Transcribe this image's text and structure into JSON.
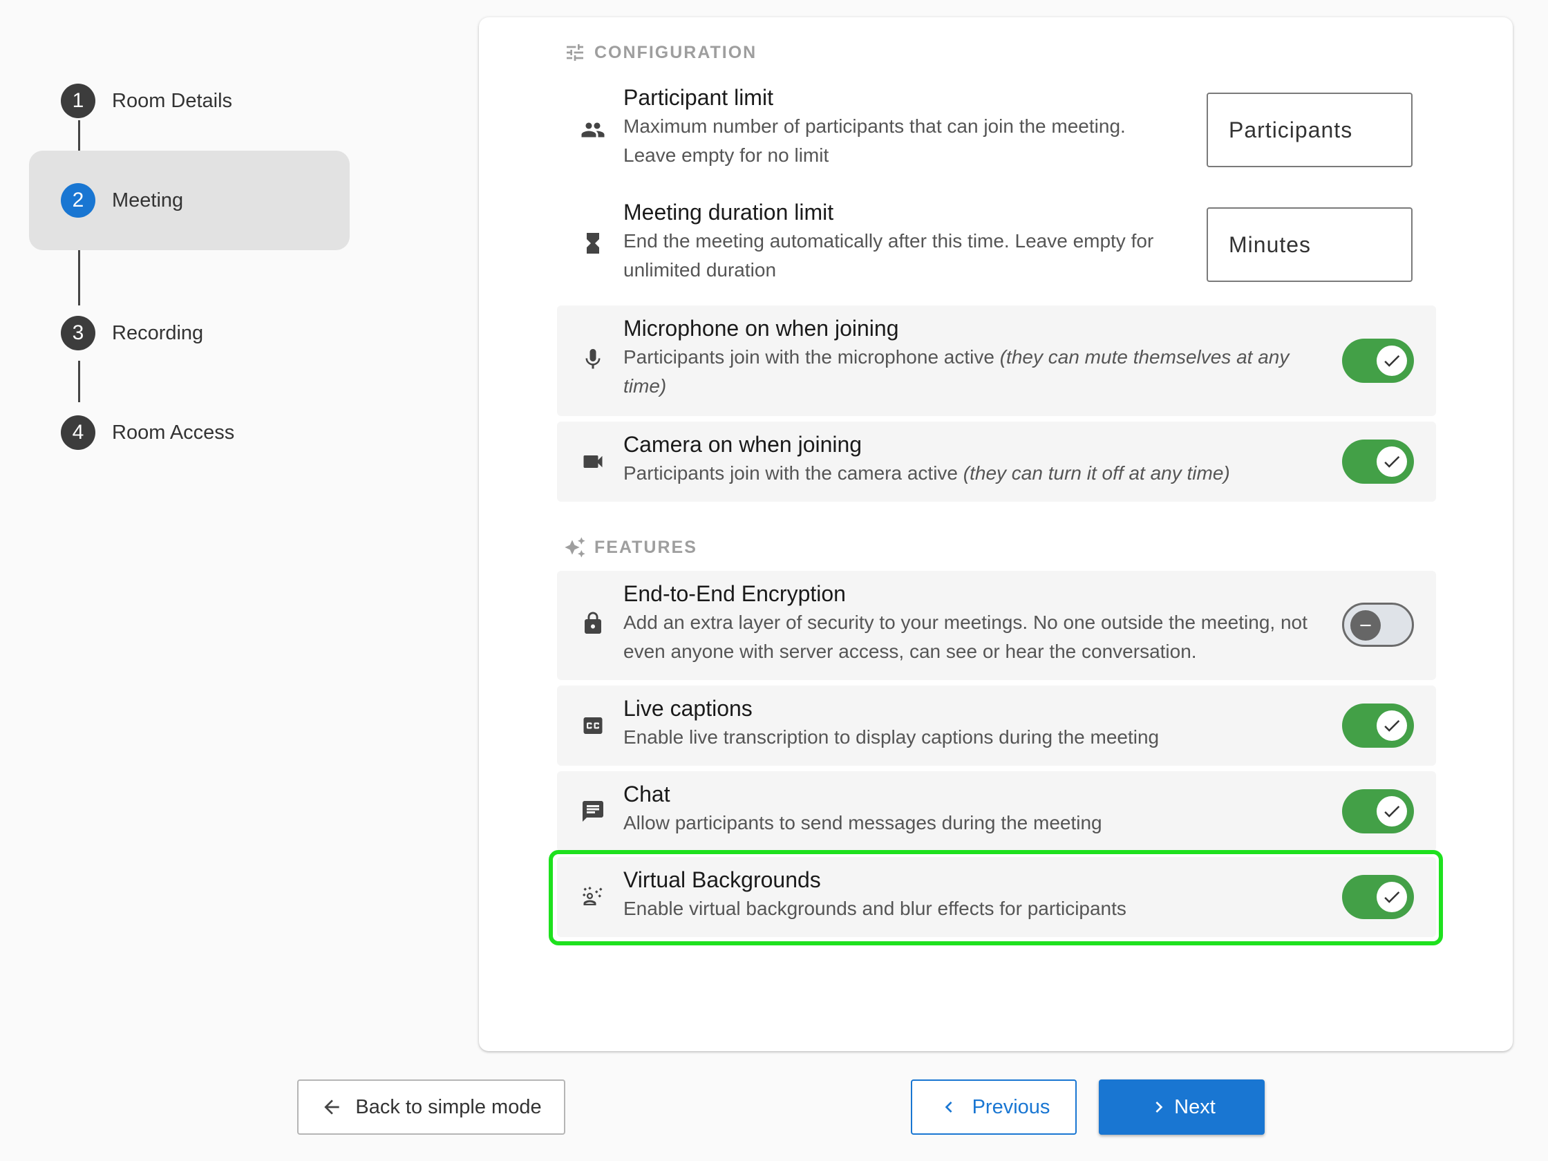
{
  "stepper": {
    "steps": [
      {
        "number": "1",
        "label": "Room Details"
      },
      {
        "number": "2",
        "label": "Meeting"
      },
      {
        "number": "3",
        "label": "Recording"
      },
      {
        "number": "4",
        "label": "Room Access"
      }
    ],
    "active_step": 2
  },
  "configuration": {
    "header": "CONFIGURATION",
    "participant_limit": {
      "title": "Participant limit",
      "description": "Maximum number of participants that can join the meeting. Leave empty for no limit",
      "placeholder": "Participants"
    },
    "duration_limit": {
      "title": "Meeting duration limit",
      "description": "End the meeting automatically after this time. Leave empty for unlimited duration",
      "placeholder": "Minutes"
    },
    "microphone": {
      "title": "Microphone on when joining",
      "description": "Participants join with the microphone active ",
      "description_note": "(they can mute themselves at any time)",
      "enabled": true
    },
    "camera": {
      "title": "Camera on when joining",
      "description": "Participants join with the camera active ",
      "description_note": "(they can turn it off at any time)",
      "enabled": true
    }
  },
  "features": {
    "header": "FEATURES",
    "encryption": {
      "title": "End-to-End Encryption",
      "description": "Add an extra layer of security to your meetings. No one outside the meeting, not even anyone with server access, can see or hear the conversation.",
      "enabled": false
    },
    "captions": {
      "title": "Live captions",
      "description": "Enable live transcription to display captions during the meeting",
      "enabled": true
    },
    "chat": {
      "title": "Chat",
      "description": "Allow participants to send messages during the meeting",
      "enabled": true
    },
    "virtual_backgrounds": {
      "title": "Virtual Backgrounds",
      "description": "Enable virtual backgrounds and blur effects for participants",
      "enabled": true
    }
  },
  "footer": {
    "back_label": "Back to simple mode",
    "previous_label": "Previous",
    "next_label": "Next"
  },
  "colors": {
    "accent": "#1976d2",
    "toggle_on": "#43a047",
    "highlight": "#1ee11e"
  },
  "icons": {
    "configuration": "tune-icon",
    "participants": "group-icon",
    "duration": "hourglass-icon",
    "microphone": "mic-icon",
    "camera": "videocam-icon",
    "features": "sparkle-icon",
    "encryption": "lock-icon",
    "captions": "closed-caption-icon",
    "chat": "chat-icon",
    "virtual_backgrounds": "background-replace-icon"
  }
}
